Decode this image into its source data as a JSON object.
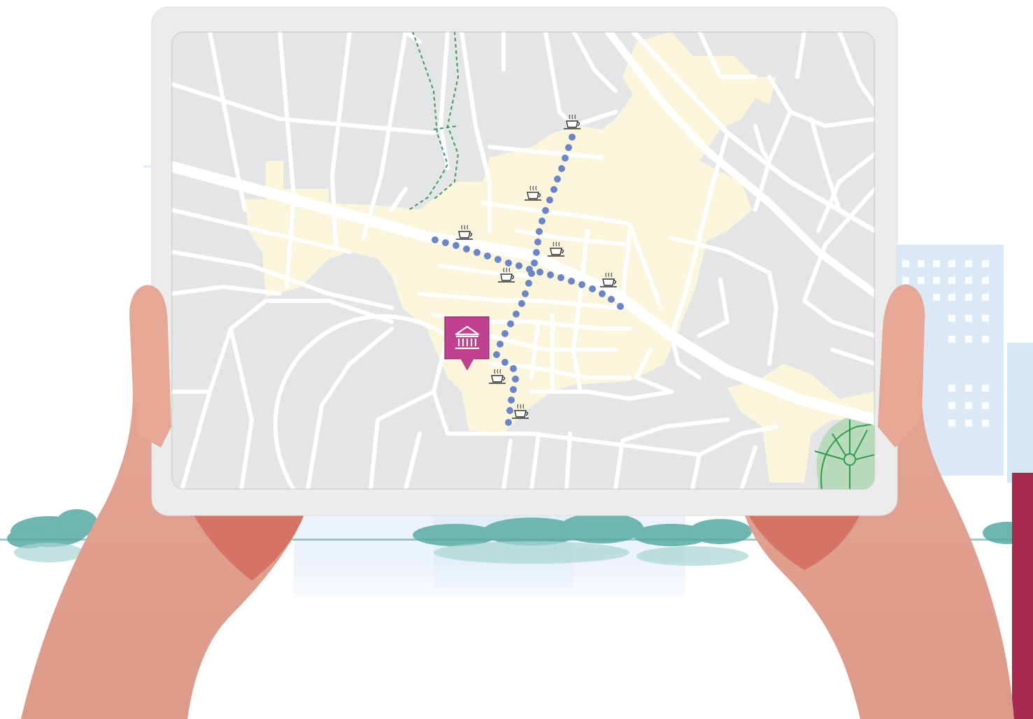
{
  "scene": {
    "device": "tablet",
    "background_colors": {
      "sky_building": "#dbe9f6",
      "trees": "#6fb5b1",
      "side_panel": "#a8284e",
      "skin": "#e1a08f",
      "skin_dark": "#d46f5f",
      "tablet_frame": "#ececec"
    }
  },
  "map": {
    "colors": {
      "land": "#e4e5e7",
      "streets": "#ffffff",
      "pedestrian_zone": "#fbf5dc",
      "park": "#b9dbbb",
      "park_paths": "#2f9b4d",
      "trail": "#3d9a55",
      "walking_route": "#6b86c8",
      "poi_marker": "#c0418d"
    },
    "route": {
      "style": "dotted",
      "legs": 2
    },
    "poi_marker": {
      "icon": "museum-icon",
      "type": "landmark"
    },
    "cafe_icon": "coffee-cup-icon",
    "cafe_count": 8
  }
}
